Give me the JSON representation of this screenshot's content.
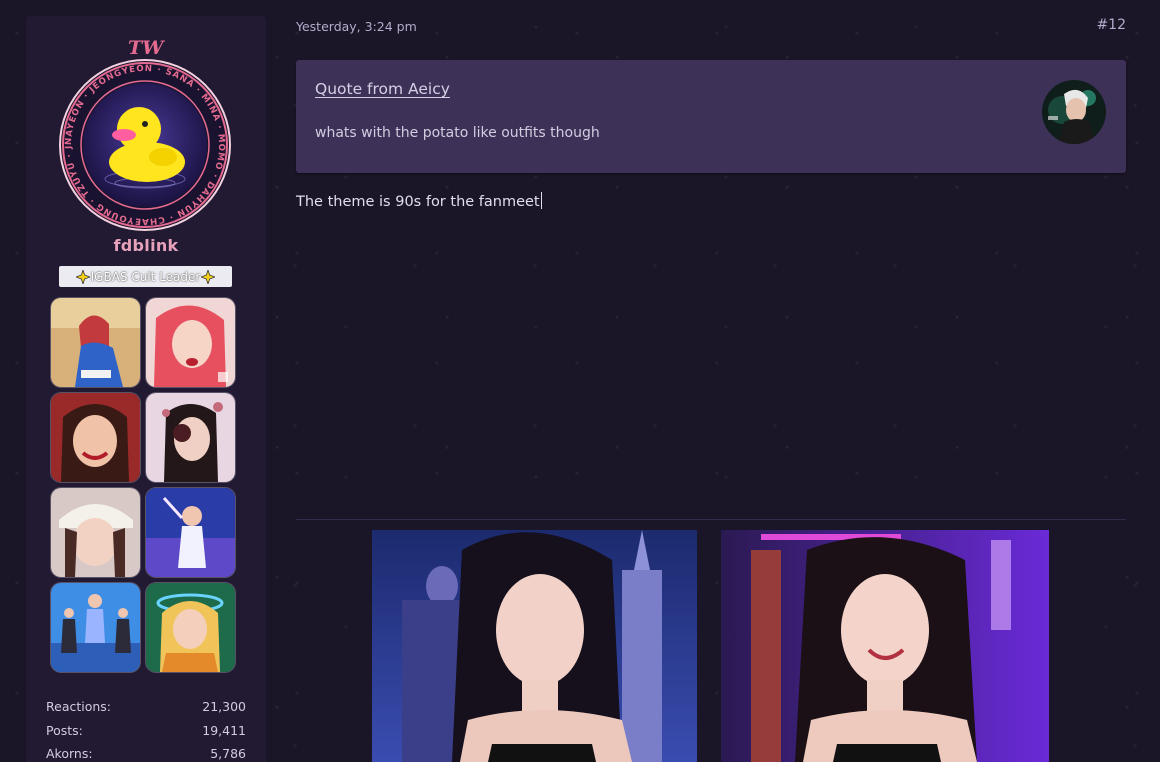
{
  "user": {
    "badge_ring_names": "NAYEON · JEONGYEON · SANA · MINA · MOMO · DAHYUN · CHAEYOUNG · TZUYU · JIHYO ·",
    "logo_text": "TW",
    "username": "fdblink",
    "title": "IGBAS Cult Leader",
    "gallery_icons": [
      "photo-icon",
      "photo-icon",
      "photo-icon",
      "photo-icon",
      "photo-icon",
      "photo-icon",
      "photo-icon",
      "photo-icon"
    ],
    "stats": [
      {
        "label": "Reactions:",
        "value": "21,300"
      },
      {
        "label": "Posts:",
        "value": "19,411"
      },
      {
        "label": "Akorns:",
        "value": "5,786"
      }
    ]
  },
  "post": {
    "date": "Yesterday, 3:24 pm",
    "number": "#12",
    "quote": {
      "from": "Quote from Aeicy",
      "text": "whats with the potato like outfits though"
    },
    "body": "The theme is 90s for the fanmeet"
  },
  "colors": {
    "background": "#1b1528",
    "sidebar": "#221a33",
    "quote_bg": "#3e3157",
    "username": "#e8a1bb",
    "accent_pink": "#e46b8f"
  }
}
